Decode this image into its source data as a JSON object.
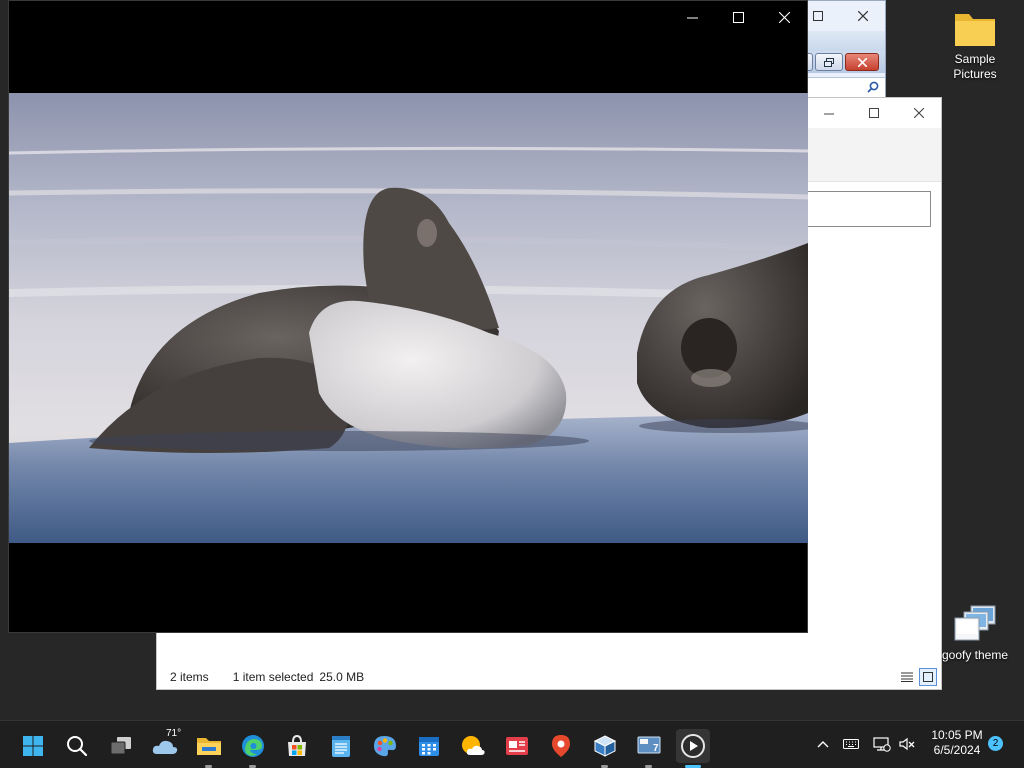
{
  "desktop": {
    "icons": [
      {
        "label": "Sample Pictures",
        "icon": "folder-icon"
      },
      {
        "label": "goofy theme",
        "icon": "theme-pictures-icon"
      }
    ]
  },
  "explorer": {
    "status": {
      "items": "2 items",
      "selected": "1 item selected",
      "size": "25.0 MB"
    },
    "view_buttons": [
      "details-view-icon",
      "large-icons-view-icon"
    ]
  },
  "player": {
    "content": "seals-on-beach-video-frame"
  },
  "taskbar": {
    "weather_temp": "71°",
    "apps": [
      {
        "name": "start",
        "icon": "windows-start-icon"
      },
      {
        "name": "search",
        "icon": "search-icon"
      },
      {
        "name": "task-view",
        "icon": "task-view-icon"
      },
      {
        "name": "weather",
        "icon": "weather-cloud-icon"
      },
      {
        "name": "file-explorer",
        "icon": "file-explorer-icon"
      },
      {
        "name": "edge",
        "icon": "edge-browser-icon"
      },
      {
        "name": "store",
        "icon": "microsoft-store-icon"
      },
      {
        "name": "notepad",
        "icon": "notepad-icon"
      },
      {
        "name": "paint",
        "icon": "paint-palette-icon"
      },
      {
        "name": "calendar",
        "icon": "calendar-icon"
      },
      {
        "name": "weather-app",
        "icon": "sun-cloud-icon"
      },
      {
        "name": "news",
        "icon": "news-icon"
      },
      {
        "name": "maps",
        "icon": "map-pin-icon"
      },
      {
        "name": "virtualbox",
        "icon": "cube-icon"
      },
      {
        "name": "windows7-vm",
        "icon": "windows7-icon"
      },
      {
        "name": "media-player",
        "icon": "media-player-icon"
      }
    ],
    "clock_time": "10:05 PM",
    "clock_date": "6/5/2024",
    "notification_count": "2"
  },
  "colors": {
    "accent": "#4cc2ff",
    "taskbar": "#1f1f1f",
    "desktop": "#272727"
  }
}
